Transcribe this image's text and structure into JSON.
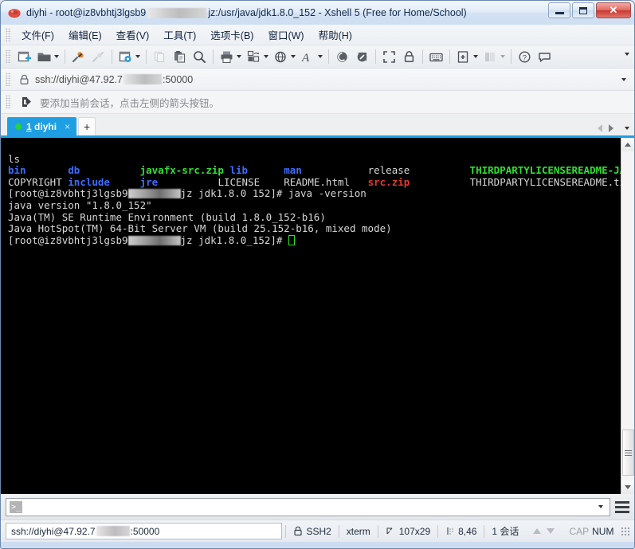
{
  "window": {
    "title_prefix": "diyhi - root@iz8vbhtj3lgsb9",
    "title_suffix": "jz:/usr/java/jdk1.8.0_152 - Xshell 5 (Free for Home/School)",
    "icon": "xshell-logo-icon",
    "buttons": {
      "minimize": "minimize-button",
      "maximize": "maximize-button",
      "close_label": "✕"
    }
  },
  "menubar": {
    "items": [
      {
        "label": "文件(F)",
        "name": "menu-file"
      },
      {
        "label": "编辑(E)",
        "name": "menu-edit"
      },
      {
        "label": "查看(V)",
        "name": "menu-view"
      },
      {
        "label": "工具(T)",
        "name": "menu-tools"
      },
      {
        "label": "选项卡(B)",
        "name": "menu-tabs"
      },
      {
        "label": "窗口(W)",
        "name": "menu-window"
      },
      {
        "label": "帮助(H)",
        "name": "menu-help"
      }
    ]
  },
  "toolbar": {
    "items": [
      {
        "name": "new-session-icon",
        "disabled": false,
        "caret": false
      },
      {
        "name": "open-folder-icon",
        "disabled": false,
        "caret": true
      },
      {
        "name": "separator",
        "disabled": false,
        "caret": false
      },
      {
        "name": "connect-icon",
        "disabled": false,
        "caret": false
      },
      {
        "name": "disconnect-icon",
        "disabled": true,
        "caret": false
      },
      {
        "name": "separator",
        "disabled": false,
        "caret": false
      },
      {
        "name": "session-properties-icon",
        "disabled": false,
        "caret": true
      },
      {
        "name": "separator",
        "disabled": false,
        "caret": false
      },
      {
        "name": "copy-icon",
        "disabled": true,
        "caret": false
      },
      {
        "name": "paste-icon",
        "disabled": false,
        "caret": false
      },
      {
        "name": "find-icon",
        "disabled": false,
        "caret": false
      },
      {
        "name": "separator",
        "disabled": false,
        "caret": false
      },
      {
        "name": "print-icon",
        "disabled": false,
        "caret": true
      },
      {
        "name": "arrange-windows-icon",
        "disabled": false,
        "caret": true
      },
      {
        "name": "globe-icon",
        "disabled": false,
        "caret": true
      },
      {
        "name": "font-icon",
        "disabled": false,
        "caret": true
      },
      {
        "name": "separator",
        "disabled": false,
        "caret": false
      },
      {
        "name": "transfer-sftp-icon",
        "disabled": false,
        "caret": false
      },
      {
        "name": "transfer-ftp-icon",
        "disabled": false,
        "caret": false
      },
      {
        "name": "separator",
        "disabled": false,
        "caret": false
      },
      {
        "name": "fullscreen-icon",
        "disabled": false,
        "caret": false
      },
      {
        "name": "lock-icon",
        "disabled": false,
        "caret": false
      },
      {
        "name": "separator",
        "disabled": false,
        "caret": false
      },
      {
        "name": "keyboard-icon",
        "disabled": false,
        "caret": false
      },
      {
        "name": "separator",
        "disabled": false,
        "caret": false
      },
      {
        "name": "add-note-icon",
        "disabled": false,
        "caret": true
      },
      {
        "name": "split-view-icon",
        "disabled": true,
        "caret": true
      },
      {
        "name": "separator",
        "disabled": false,
        "caret": false
      },
      {
        "name": "help-icon",
        "disabled": false,
        "caret": false
      },
      {
        "name": "chat-icon",
        "disabled": false,
        "caret": false
      }
    ],
    "overflow": "toolbar-overflow-icon"
  },
  "address": {
    "icon": "lock-icon",
    "url_prefix": "ssh://diyhi@47.92.7",
    "url_suffix": ":50000",
    "dropdown": "address-dropdown-icon"
  },
  "notice": {
    "icon": "add-session-arrow-icon",
    "text": "要添加当前会话，点击左侧的箭头按钮。"
  },
  "tabs": {
    "items": [
      {
        "index": "1",
        "label": "diyhi",
        "active": true,
        "status": "connected",
        "close": "×"
      }
    ],
    "add_label": "+",
    "nav_prev": "tab-prev-icon",
    "nav_next": "tab-next-icon",
    "nav_list": "tab-list-icon"
  },
  "terminal": {
    "prompt_prefix": "[root@iz8vbhtj3lgsb9",
    "prompt_suffix": "jz jdk1.8.0 152]#",
    "prompt_suffix2": "jz jdk1.8.0_152]#",
    "lines": {
      "cmd_ls": "ls",
      "ls_row1": [
        {
          "text": "bin",
          "color": "dir"
        },
        {
          "text": "db",
          "color": "dir"
        },
        {
          "text": "javafx-src.zip",
          "color": "archive"
        },
        {
          "text": "lib",
          "color": "dir"
        },
        {
          "text": "man",
          "color": "dir"
        },
        {
          "text": "release",
          "color": "file"
        },
        {
          "text": "THIRDPARTYLICENSEREADME-JAVAFX.txt",
          "color": "archive"
        }
      ],
      "ls_row2": [
        {
          "text": "COPYRIGHT",
          "color": "file"
        },
        {
          "text": "include",
          "color": "dir"
        },
        {
          "text": "jre",
          "color": "dir"
        },
        {
          "text": "LICENSE",
          "color": "file"
        },
        {
          "text": "README.html",
          "color": "file"
        },
        {
          "text": "src.zip",
          "color": "red"
        },
        {
          "text": "THIRDPARTYLICENSEREADME.txt",
          "color": "file"
        }
      ],
      "cmd_java": " java -version",
      "out1": "java version \"1.8.0_152\"",
      "out2": "Java(TM) SE Runtime Environment (build 1.8.0_152-b16)",
      "out3": "Java HotSpot(TM) 64-Bit Server VM (build 25.152-b16, mixed mode)"
    }
  },
  "command_bar": {
    "icon": ">_",
    "value": "",
    "placeholder": "",
    "dropdown": "command-history-dropdown-icon",
    "menu": "command-bar-menu-icon"
  },
  "statusbar": {
    "url_prefix": "ssh://diyhi@47.92.7",
    "url_suffix": ":50000",
    "security_icon": "lock-icon",
    "protocol": "SSH2",
    "terminal_type": "xterm",
    "size_icon": "terminal-size-icon",
    "size": "107x29",
    "cursor_icon": "cursor-position-icon",
    "cursor": "8,46",
    "sessions": "1 会话",
    "upload_icon": "upload-arrow-icon",
    "download_icon": "download-arrow-icon",
    "caps": "CAP",
    "num": "NUM"
  },
  "colors": {
    "accent": "#1e9fe3",
    "terminal_bg": "#000000",
    "dir": "#3c6dff",
    "archive": "#2fe02f",
    "red": "#e03a2f",
    "file": "#d8d8d8",
    "connected_dot": "#27d045"
  }
}
